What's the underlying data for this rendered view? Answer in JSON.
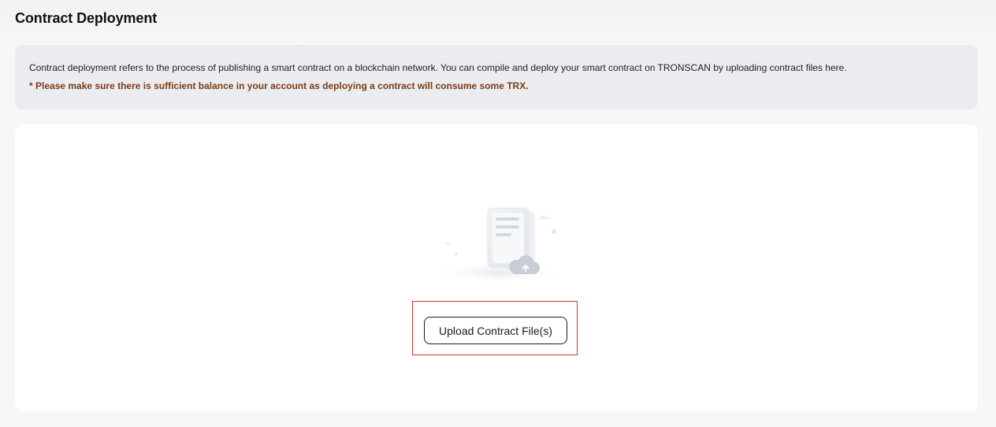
{
  "page": {
    "title": "Contract Deployment"
  },
  "info": {
    "description": "Contract deployment refers to the process of publishing a smart contract on a blockchain network. You can compile and deploy your smart contract on TRONSCAN by uploading contract files here.",
    "warning": "* Please make sure there is sufficient balance in your account as deploying a contract will consume some TRX."
  },
  "upload": {
    "illustration_icon": "document-upload-icon",
    "button_label": "Upload Contract File(s)"
  },
  "colors": {
    "warning_text": "#7a3d12",
    "highlight_border": "#e0341e",
    "info_background": "#ebecf0"
  }
}
